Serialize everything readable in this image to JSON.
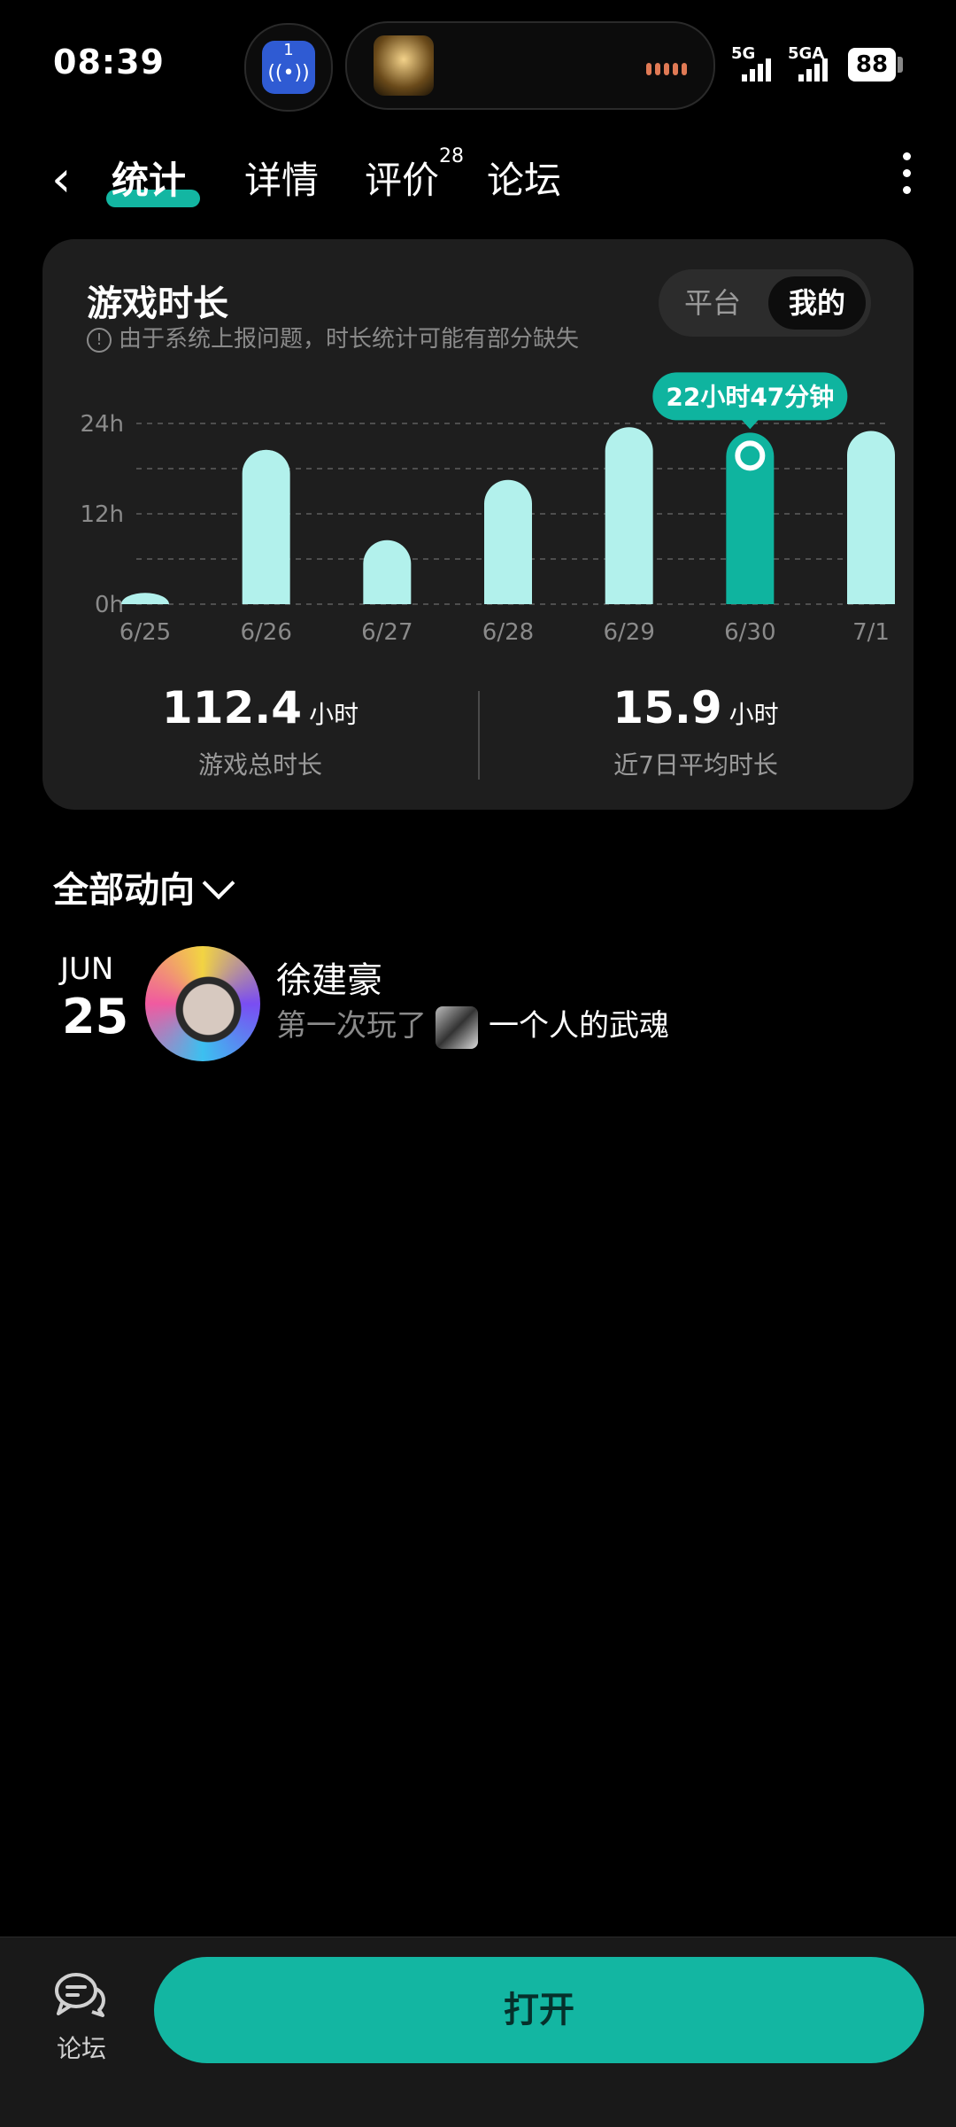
{
  "status_bar": {
    "time": "08:39",
    "island_badge": "1",
    "network1": "5G",
    "network2": "5GA",
    "battery": "88"
  },
  "nav": {
    "tabs": [
      {
        "label": "统计",
        "active": true
      },
      {
        "label": "详情"
      },
      {
        "label": "评价",
        "badge": "28"
      },
      {
        "label": "论坛"
      }
    ]
  },
  "card": {
    "title": "游戏时长",
    "notice": "由于系统上报问题，时长统计可能有部分缺失",
    "segment": [
      "平台",
      "我的"
    ],
    "segment_selected": "我的",
    "stats": [
      {
        "value": "112.4",
        "unit": "小时",
        "label": "游戏总时长"
      },
      {
        "value": "15.9",
        "unit": "小时",
        "label": "近7日平均时长"
      }
    ]
  },
  "chart_data": {
    "type": "bar",
    "categories": [
      "6/25",
      "6/26",
      "6/27",
      "6/28",
      "6/29",
      "6/30",
      "7/1"
    ],
    "values": [
      1.5,
      20.5,
      8.5,
      16.5,
      23.5,
      22.78,
      23.0
    ],
    "highlight_index": 5,
    "tooltip": "22小时47分钟",
    "yticks": [
      "24h",
      "12h",
      "0h"
    ],
    "ylim": [
      0,
      24
    ],
    "colors": {
      "bar": "#b2f1ec",
      "highlight": "#0fb49f"
    }
  },
  "activity": {
    "filter_label": "全部动向",
    "items": [
      {
        "month": "JUN",
        "day": "25",
        "user": "徐建豪",
        "action": "第一次玩了",
        "game": "一个人的武魂"
      }
    ]
  },
  "bottom": {
    "forum_label": "论坛",
    "open_label": "打开"
  }
}
